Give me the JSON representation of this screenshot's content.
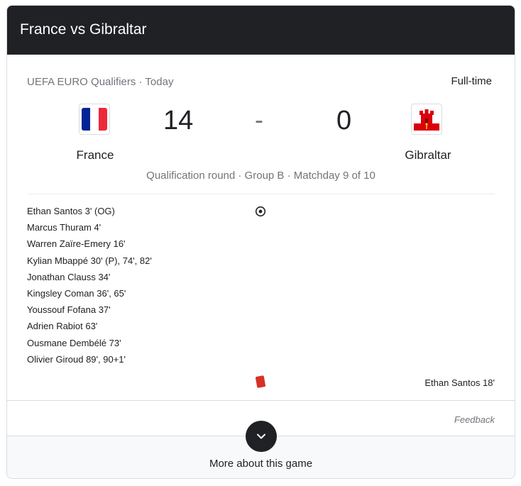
{
  "header": {
    "title": "France vs Gibraltar"
  },
  "match": {
    "competition": "UEFA EURO Qualifiers · Today",
    "status": "Full-time",
    "round": "Qualification round · Group B · Matchday 9 of 10"
  },
  "home": {
    "name": "France",
    "score": "14",
    "flag_icon": "france-flag-icon",
    "colors": [
      "#002395",
      "#ffffff",
      "#ed2939"
    ]
  },
  "away": {
    "name": "Gibraltar",
    "score": "0",
    "flag_icon": "gibraltar-flag-icon",
    "colors": [
      "#ffffff",
      "#da000c",
      "#f8d000"
    ]
  },
  "score_separator": "-",
  "home_scorers": [
    "Ethan Santos 3' (OG)",
    "Marcus Thuram 4'",
    "Warren Zaïre-Emery 16'",
    "Kylian Mbappé 30' (P), 74', 82'",
    "Jonathan Clauss 34'",
    "Kingsley Coman 36', 65'",
    "Youssouf Fofana 37'",
    "Adrien Rabiot 63'",
    "Ousmane Dembélé 73'",
    "Olivier Giroud 89', 90+1'"
  ],
  "events": {
    "goal_icon": "soccer-ball-icon",
    "card_icon": "red-card-icon",
    "red_card_color": "#d93025",
    "away_red_card": "Ethan Santos 18'"
  },
  "footer": {
    "feedback": "Feedback",
    "more_label": "More about this game",
    "expand_icon": "chevron-down-icon"
  }
}
